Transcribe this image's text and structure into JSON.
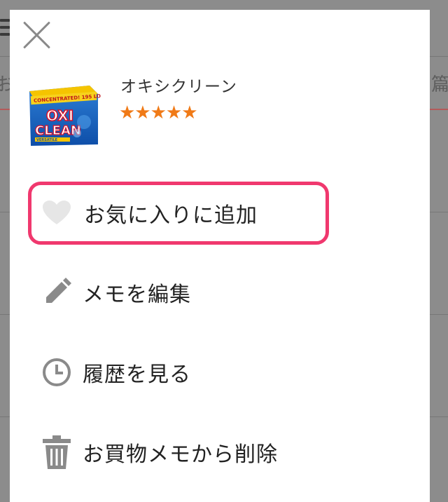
{
  "product": {
    "name": "オキシクリーン",
    "rating_stars": "★★★★★",
    "rating_value": 5,
    "thumb_text": {
      "top": "CONCENTRATED! 195 LOADS",
      "logo_line1": "OXI",
      "logo_line2": "CLEAN",
      "bottom": "VERSATILE"
    }
  },
  "actions": [
    {
      "label": "お気に入りに追加",
      "icon": "heart-icon"
    },
    {
      "label": "メモを編集",
      "icon": "pencil-icon"
    },
    {
      "label": "履歴を見る",
      "icon": "clock-icon"
    },
    {
      "label": "お買物メモから削除",
      "icon": "trash-icon"
    }
  ],
  "colors": {
    "highlight_border": "#f0386e",
    "star": "#f07a17",
    "icon": "#8a8a8a"
  }
}
